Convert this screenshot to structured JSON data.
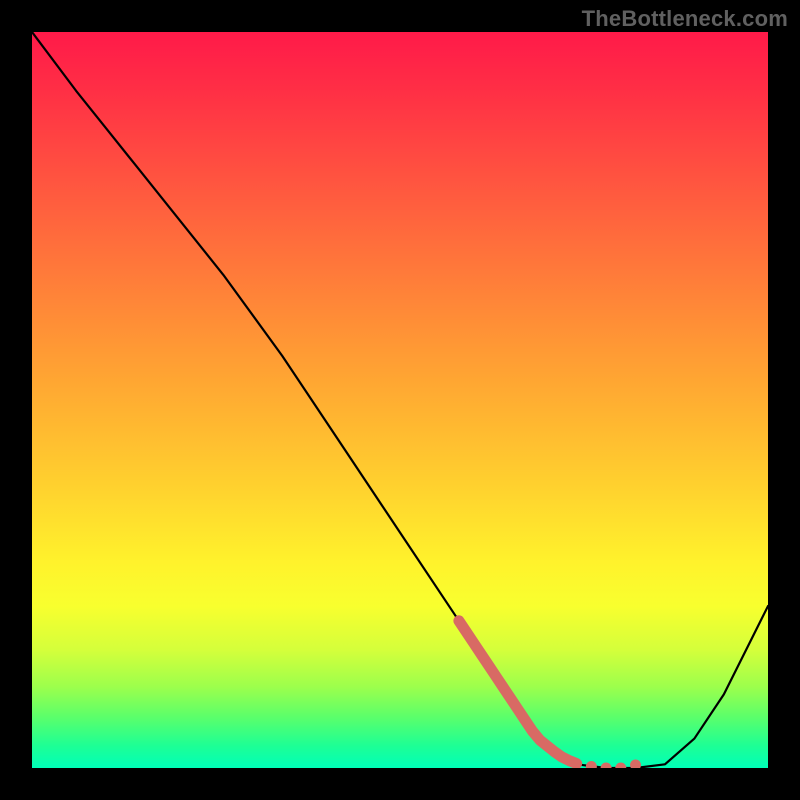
{
  "watermark": "TheBottleneck.com",
  "chart_data": {
    "type": "line",
    "title": "",
    "xlabel": "",
    "ylabel": "",
    "xlim": [
      0,
      100
    ],
    "ylim": [
      0,
      100
    ],
    "gradient_note": "vertical red→yellow→green gradient background (top=high/red, bottom=low/green) representing bottleneck severity",
    "series": [
      {
        "name": "bottleneck-curve",
        "x": [
          0,
          6,
          14,
          22,
          26,
          34,
          42,
          50,
          58,
          62,
          66,
          70,
          74,
          78,
          82,
          86,
          90,
          94,
          100
        ],
        "y": [
          100,
          92,
          82,
          72,
          67,
          56,
          44,
          32,
          20,
          14,
          8,
          3,
          0.5,
          0,
          0,
          0.5,
          4,
          10,
          22
        ]
      }
    ],
    "highlight_points": {
      "name": "optimal-range-marker",
      "color": "#d86a64",
      "points": [
        {
          "x": 58,
          "y": 20
        },
        {
          "x": 59,
          "y": 18.5
        },
        {
          "x": 60,
          "y": 17
        },
        {
          "x": 61,
          "y": 15.5
        },
        {
          "x": 62,
          "y": 14
        },
        {
          "x": 63,
          "y": 12.5
        },
        {
          "x": 64,
          "y": 11
        },
        {
          "x": 65,
          "y": 9.5
        },
        {
          "x": 66,
          "y": 8
        },
        {
          "x": 67,
          "y": 6.5
        },
        {
          "x": 68,
          "y": 5
        },
        {
          "x": 69,
          "y": 3.8
        },
        {
          "x": 70,
          "y": 3
        },
        {
          "x": 71,
          "y": 2.2
        },
        {
          "x": 72,
          "y": 1.5
        },
        {
          "x": 73,
          "y": 1
        },
        {
          "x": 74,
          "y": 0.6
        },
        {
          "x": 76,
          "y": 0.2
        },
        {
          "x": 78,
          "y": 0
        },
        {
          "x": 80,
          "y": 0
        },
        {
          "x": 82,
          "y": 0.4
        }
      ]
    }
  }
}
